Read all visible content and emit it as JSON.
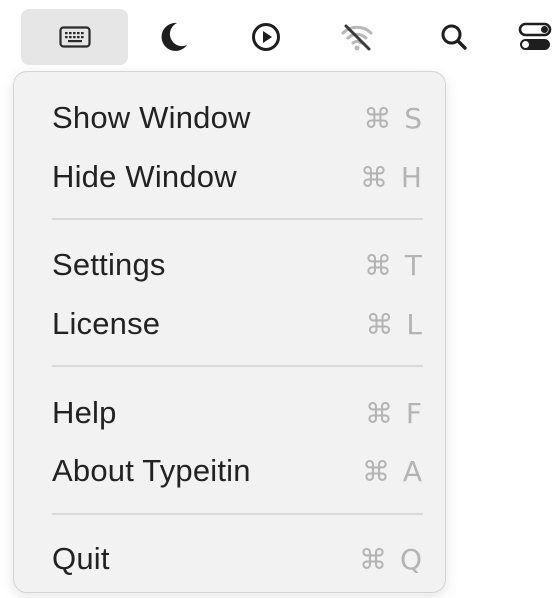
{
  "menubar": {
    "icons": [
      {
        "name": "keyboard-icon",
        "active": true
      },
      {
        "name": "moon-icon"
      },
      {
        "name": "play-circle-icon"
      },
      {
        "name": "wifi-off-icon"
      },
      {
        "name": "search-icon"
      },
      {
        "name": "control-center-icon"
      }
    ]
  },
  "menu": {
    "items": [
      {
        "label": "Show Window",
        "shortcut": "⌘ S"
      },
      {
        "label": "Hide Window",
        "shortcut": "⌘ H"
      },
      {
        "label": "Settings",
        "shortcut": "⌘ T"
      },
      {
        "label": "License",
        "shortcut": "⌘ L"
      },
      {
        "label": "Help",
        "shortcut": "⌘ F"
      },
      {
        "label": "About Typeitin",
        "shortcut": "⌘ A"
      },
      {
        "label": "Quit",
        "shortcut": "⌘ Q"
      }
    ]
  },
  "colors": {
    "menu_background": "#f2f2f2",
    "label": "#222222",
    "shortcut": "#b4b4b4",
    "separator": "#d9d9d9",
    "active_highlight": "#e6e6e6"
  }
}
